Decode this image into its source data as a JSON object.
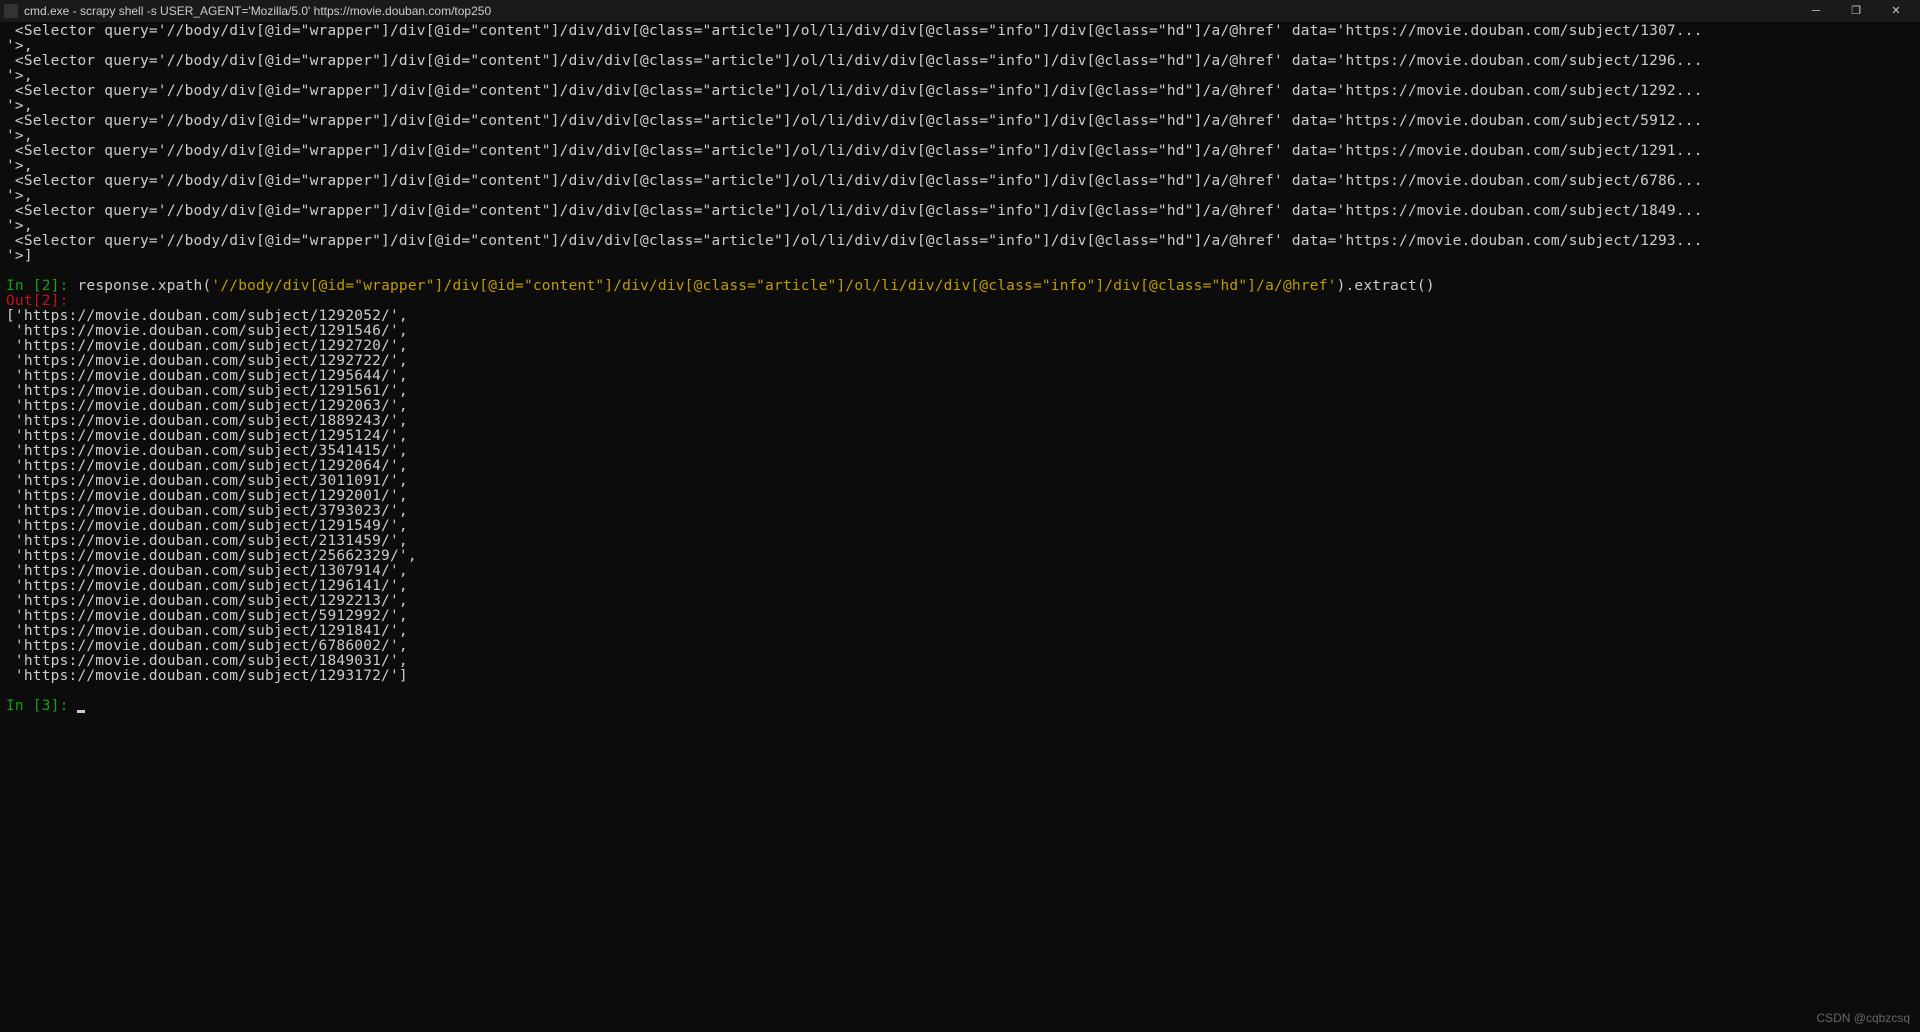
{
  "titlebar": {
    "text": "cmd.exe - scrapy  shell -s USER_AGENT='Mozilla/5.0' https://movie.douban.com/top250"
  },
  "selector_query": "//body/div[@id=\"wrapper\"]/div[@id=\"content\"]/div/div[@class=\"article\"]/ol/li/div/div[@class=\"info\"]/div[@class=\"hd\"]/a/@href",
  "selectors": [
    "https://movie.douban.com/subject/1307...",
    "https://movie.douban.com/subject/1296...",
    "https://movie.douban.com/subject/1292...",
    "https://movie.douban.com/subject/5912...",
    "https://movie.douban.com/subject/1291...",
    "https://movie.douban.com/subject/6786...",
    "https://movie.douban.com/subject/1849...",
    "https://movie.douban.com/subject/1293..."
  ],
  "input_prompt": {
    "in_label": "In [2]: ",
    "method": "response.xpath(",
    "xpath_arg": "'//body/div[@id=\"wrapper\"]/div[@id=\"content\"]/div/div[@class=\"article\"]/ol/li/div/div[@class=\"info\"]/div[@class=\"hd\"]/a/@href'",
    "method_end": ").extract()"
  },
  "output_prompt": {
    "out_label": "Out[2]:"
  },
  "urls": [
    "https://movie.douban.com/subject/1292052/",
    "https://movie.douban.com/subject/1291546/",
    "https://movie.douban.com/subject/1292720/",
    "https://movie.douban.com/subject/1292722/",
    "https://movie.douban.com/subject/1295644/",
    "https://movie.douban.com/subject/1291561/",
    "https://movie.douban.com/subject/1292063/",
    "https://movie.douban.com/subject/1889243/",
    "https://movie.douban.com/subject/1295124/",
    "https://movie.douban.com/subject/3541415/",
    "https://movie.douban.com/subject/1292064/",
    "https://movie.douban.com/subject/3011091/",
    "https://movie.douban.com/subject/1292001/",
    "https://movie.douban.com/subject/3793023/",
    "https://movie.douban.com/subject/1291549/",
    "https://movie.douban.com/subject/2131459/",
    "https://movie.douban.com/subject/25662329/",
    "https://movie.douban.com/subject/1307914/",
    "https://movie.douban.com/subject/1296141/",
    "https://movie.douban.com/subject/1292213/",
    "https://movie.douban.com/subject/5912992/",
    "https://movie.douban.com/subject/1291841/",
    "https://movie.douban.com/subject/6786002/",
    "https://movie.douban.com/subject/1849031/",
    "https://movie.douban.com/subject/1293172/"
  ],
  "next_prompt": {
    "label": "In [3]: "
  },
  "watermark": "CSDN @cqbzcsq"
}
